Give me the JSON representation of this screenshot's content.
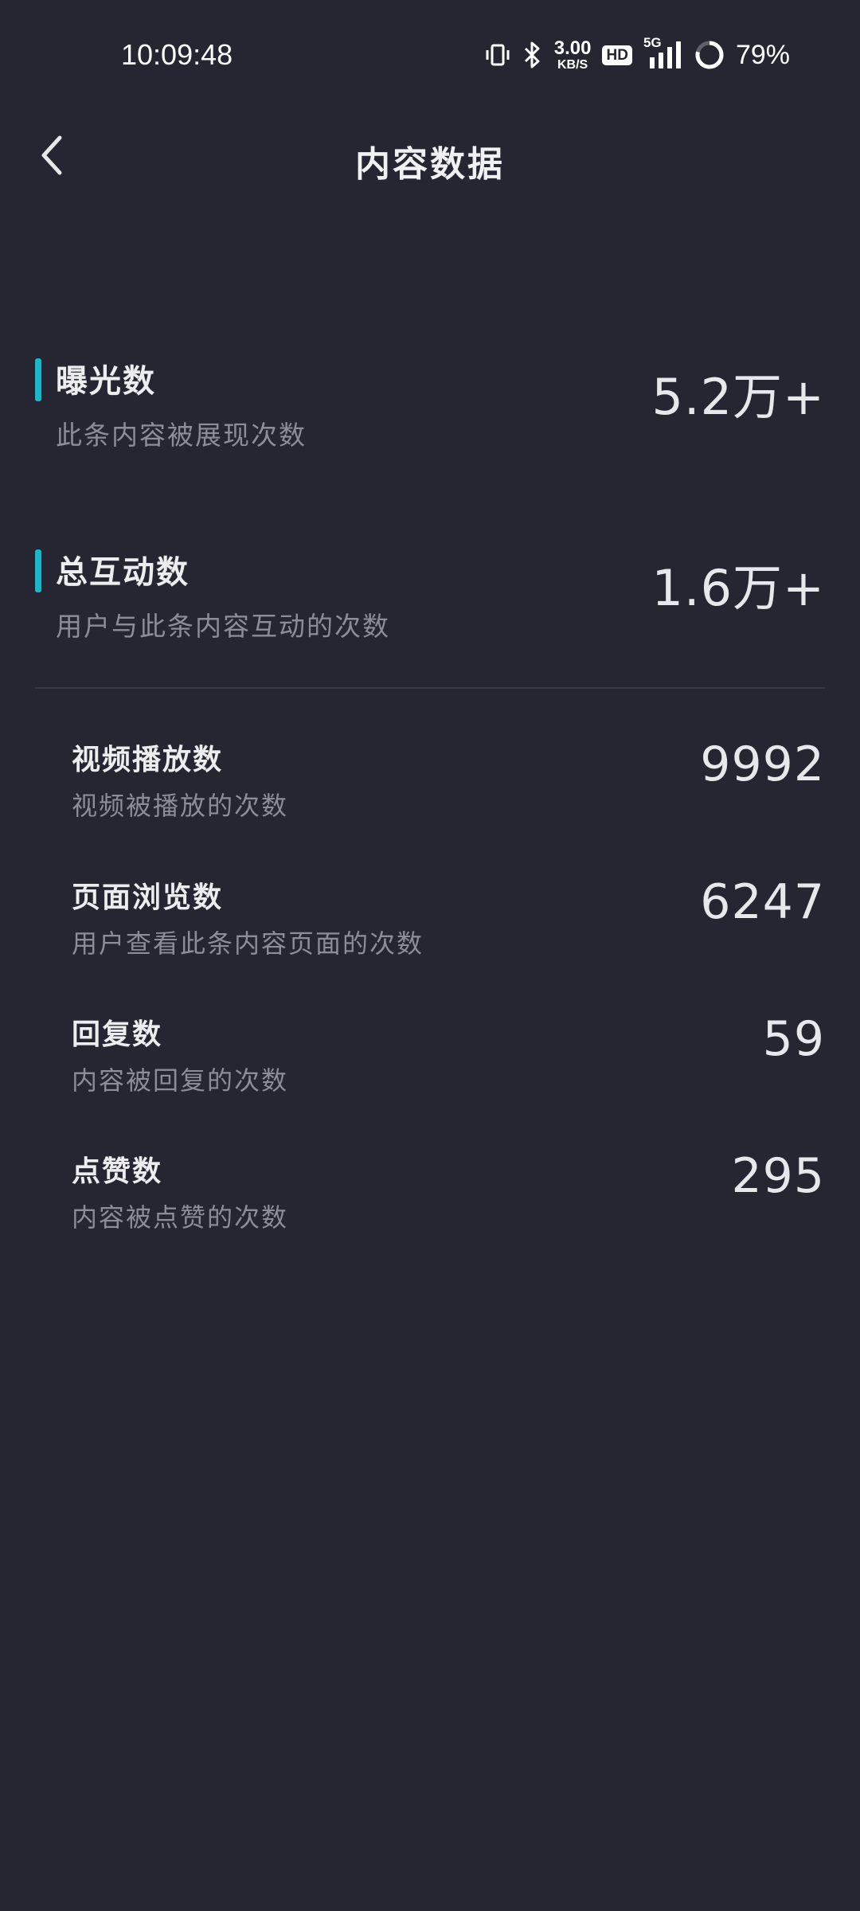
{
  "status_bar": {
    "time": "10:09:48",
    "net_speed_value": "3.00",
    "net_speed_unit": "KB/S",
    "hd_label": "HD",
    "network_type": "5G",
    "battery_percent": "79%",
    "icons": [
      "vibrate-icon",
      "bluetooth-icon",
      "signal-icon",
      "battery-ring-icon"
    ]
  },
  "header": {
    "title": "内容数据",
    "back_icon": "chevron-left-icon"
  },
  "primary_metrics": [
    {
      "title": "曝光数",
      "description": "此条内容被展现次数",
      "value": "5.2万+"
    },
    {
      "title": "总互动数",
      "description": "用户与此条内容互动的次数",
      "value": "1.6万+"
    }
  ],
  "secondary_metrics": [
    {
      "title": "视频播放数",
      "description": "视频被播放的次数",
      "value": "9992"
    },
    {
      "title": "页面浏览数",
      "description": "用户查看此条内容页面的次数",
      "value": "6247"
    },
    {
      "title": "回复数",
      "description": "内容被回复的次数",
      "value": "59"
    },
    {
      "title": "点赞数",
      "description": "内容被点赞的次数",
      "value": "295"
    }
  ],
  "colors": {
    "background": "#252631",
    "accent_bar": "#18b8c8",
    "primary_text": "#ededf0",
    "secondary_text": "#8c8d99",
    "divider": "#363845"
  }
}
